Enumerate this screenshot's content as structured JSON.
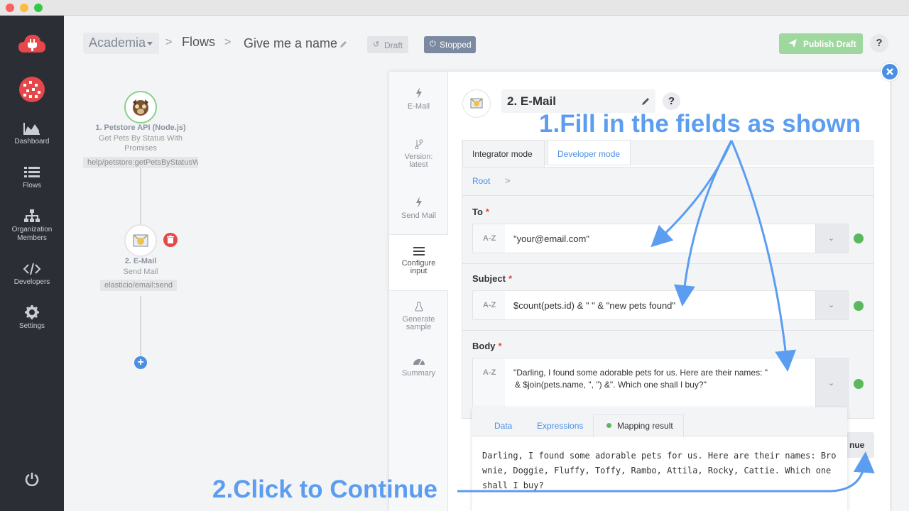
{
  "header": {
    "workspace": "Academia",
    "flows": "Flows",
    "flow_name": "Give me a name",
    "draft_label": "Draft",
    "stopped_label": "Stopped",
    "publish_label": "Publish Draft",
    "help": "?"
  },
  "sidebar": {
    "items": [
      {
        "label": "Dashboard"
      },
      {
        "label": "Flows"
      },
      {
        "label": "Organization Members"
      },
      {
        "label": "Developers"
      },
      {
        "label": "Settings"
      }
    ]
  },
  "flow": {
    "node1": {
      "title": "1. Petstore API (Node.js)",
      "sub1": "Get Pets By Status With",
      "sub2": "Promises",
      "tag": "help/petstore:getPetsByStatusW"
    },
    "node2": {
      "title": "2. E-Mail",
      "sub": "Send Mail",
      "tag": "elasticio/email:send"
    }
  },
  "steps": [
    {
      "label1": "E-Mail",
      "label2": ""
    },
    {
      "label1": "Version:",
      "label2": "latest"
    },
    {
      "label1": "Send Mail",
      "label2": ""
    },
    {
      "label1": "Configure",
      "label2": "input"
    },
    {
      "label1": "Generate",
      "label2": "sample"
    },
    {
      "label1": "Summary",
      "label2": ""
    }
  ],
  "panel": {
    "title": "2. E-Mail",
    "help": "?",
    "tabs": {
      "integrator": "Integrator mode",
      "developer": "Developer mode"
    },
    "root": "Root",
    "fields": {
      "to": {
        "label": "To",
        "az": "A-Z",
        "value": "\"your@email.com\""
      },
      "subject": {
        "label": "Subject",
        "az": "A-Z",
        "value": "$count(pets.id) & \" \" & \"new pets found\""
      },
      "body": {
        "label": "Body",
        "az": "A-Z",
        "value_line1": "\"Darling, I found some adorable pets for us. Here are their names: \"",
        "value_line2": "& $join(pets.name, \", \") &\". Which one shall I buy?\""
      }
    },
    "result_tabs": {
      "data": "Data",
      "expressions": "Expressions",
      "mapping": "Mapping result"
    },
    "result_text": "Darling, I found some adorable pets for us. Here are their names: Brownie, Doggie, Fluffy, Toffy, Rambo, Attila, Rocky, Cattie. Which one shall I buy?",
    "continue_partial": "nue"
  },
  "annotations": {
    "fill": "1.Fill in the fields as shown",
    "click": "2.Click to Continue"
  },
  "colors": {
    "sidebar_bg": "#2b2e35",
    "accent_blue": "#5b9df0",
    "publish_green": "#5cb85c",
    "stopped_bg": "#7b8aa1",
    "brand_red": "#e5474b"
  }
}
